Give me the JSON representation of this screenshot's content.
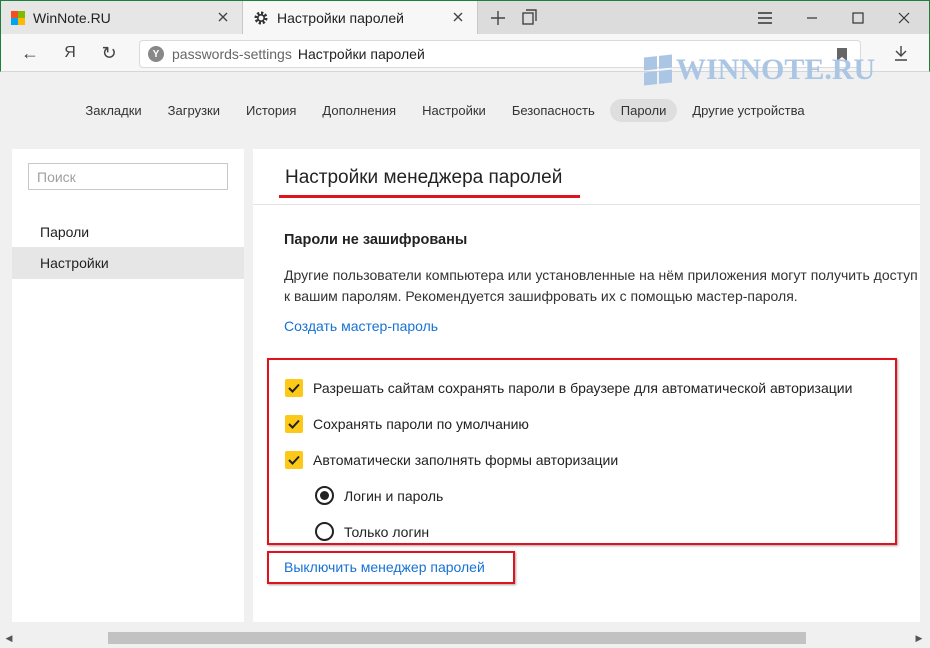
{
  "tabs": [
    {
      "title": "WinNote.RU"
    },
    {
      "title": "Настройки паролей"
    }
  ],
  "address": {
    "host": "passwords-settings",
    "page_title": "Настройки паролей",
    "back_glyph": "←",
    "yandex_glyph": "Я",
    "reload_glyph": "↻"
  },
  "watermark": {
    "text": "WINNOTE.RU"
  },
  "settings_nav": [
    {
      "label": "Закладки"
    },
    {
      "label": "Загрузки"
    },
    {
      "label": "История"
    },
    {
      "label": "Дополнения"
    },
    {
      "label": "Настройки"
    },
    {
      "label": "Безопасность"
    },
    {
      "label": "Пароли",
      "active": true
    },
    {
      "label": "Другие устройства"
    }
  ],
  "sidebar": {
    "search_placeholder": "Поиск",
    "items": [
      {
        "label": "Пароли"
      },
      {
        "label": "Настройки",
        "active": true
      }
    ]
  },
  "main": {
    "title": "Настройки менеджера паролей",
    "section_title": "Пароли не зашифрованы",
    "description": "Другие пользователи компьютера или установленные на нём приложения могут получить доступ к вашим паролям. Рекомендуется зашифровать их с помощью мастер-пароля.",
    "create_master_link": "Создать мастер-пароль",
    "checkboxes": [
      {
        "label": "Разрешать сайтам сохранять пароли в браузере для автоматической авторизации",
        "checked": true
      },
      {
        "label": "Сохранять пароли по умолчанию",
        "checked": true
      },
      {
        "label": "Автоматически заполнять формы авторизации",
        "checked": true
      }
    ],
    "radios": [
      {
        "label": "Логин и пароль",
        "selected": true
      },
      {
        "label": "Только логин",
        "selected": false
      }
    ],
    "disable_link": "Выключить менеджер паролей"
  },
  "colors": {
    "checkbox_accent": "#fcc919",
    "link": "#1672d4",
    "highlight_red": "#e0121c"
  }
}
